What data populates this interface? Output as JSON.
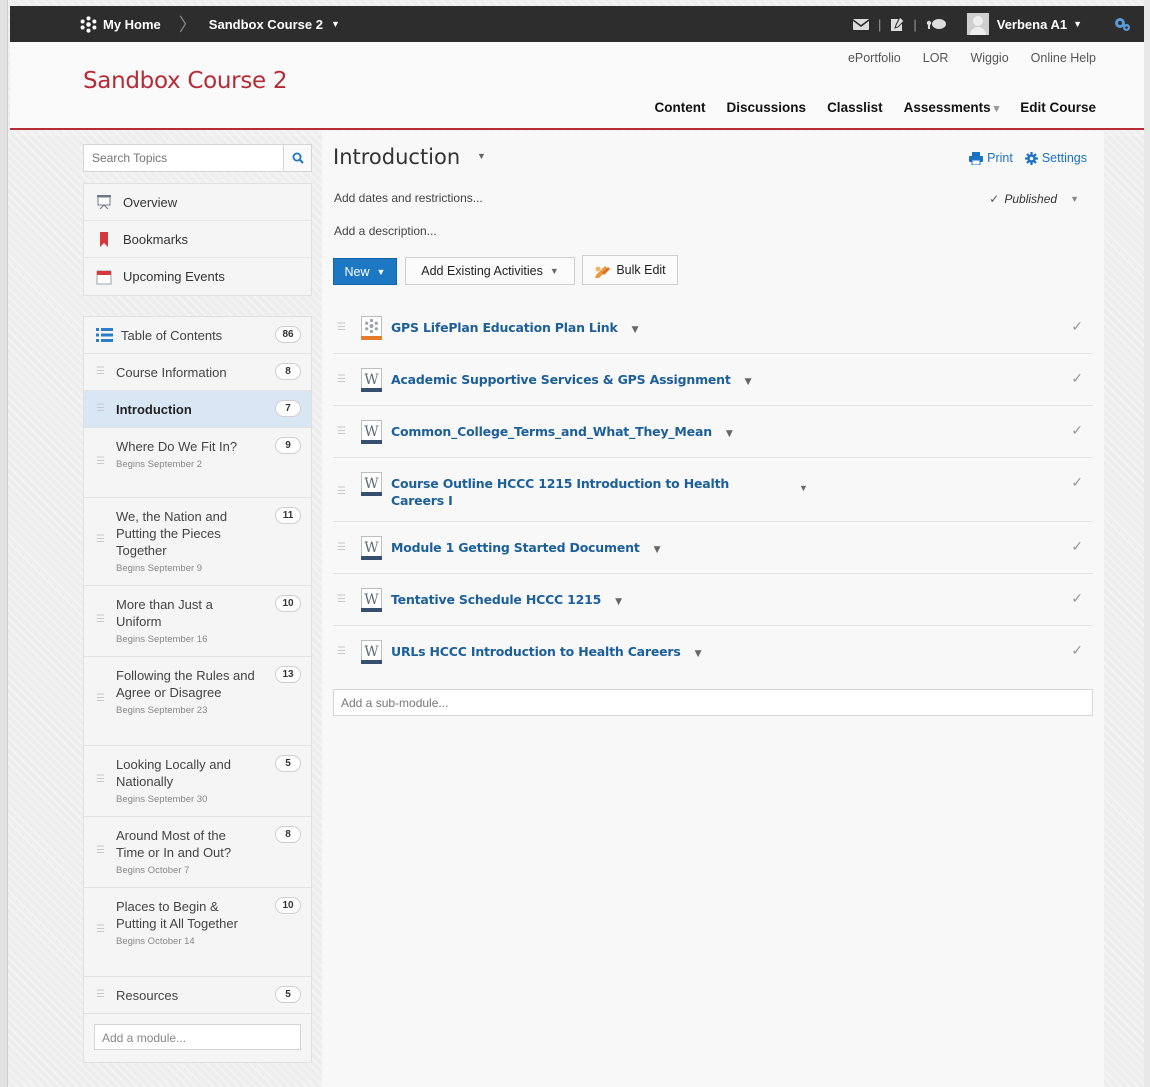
{
  "topbar": {
    "home_label": "My Home",
    "course_label": "Sandbox Course 2",
    "user_name": "Verbena A1"
  },
  "header": {
    "course_title": "Sandbox Course 2",
    "util_links": [
      "ePortfolio",
      "LOR",
      "Wiggio",
      "Online Help"
    ],
    "main_nav": [
      "Content",
      "Discussions",
      "Classlist",
      "Assessments",
      "Edit Course"
    ]
  },
  "sidebar": {
    "search_placeholder": "Search Topics",
    "nav_items": [
      "Overview",
      "Bookmarks",
      "Upcoming Events"
    ],
    "toc_label": "Table of Contents",
    "toc_count": "86",
    "modules": [
      {
        "title": "Course Information",
        "date": "",
        "count": "8"
      },
      {
        "title": "Introduction",
        "date": "",
        "count": "7"
      },
      {
        "title": "Where Do We Fit In?",
        "date": "Begins September 2",
        "count": "9"
      },
      {
        "title": "We, the Nation and Putting the Pieces Together",
        "date": "Begins September 9",
        "count": "11"
      },
      {
        "title": "More than Just a Uniform",
        "date": "Begins September 16",
        "count": "10"
      },
      {
        "title": "Following the Rules and Agree or Disagree",
        "date": "Begins September 23",
        "count": "13"
      },
      {
        "title": "Looking Locally and Nationally",
        "date": "Begins September 30",
        "count": "5"
      },
      {
        "title": "Around Most of the Time or In and Out?",
        "date": "Begins October 7",
        "count": "8"
      },
      {
        "title": "Places to Begin & Putting it All Together",
        "date": "Begins October 14",
        "count": "10"
      },
      {
        "title": "Resources",
        "date": "",
        "count": "5"
      }
    ],
    "add_module_placeholder": "Add a module..."
  },
  "main": {
    "title": "Introduction",
    "print_label": "Print",
    "settings_label": "Settings",
    "add_dates": "Add dates and restrictions...",
    "published_label": "Published",
    "add_description": "Add a description...",
    "new_button": "New",
    "add_existing_button": "Add Existing Activities",
    "bulk_edit_button": "Bulk Edit",
    "topics": [
      {
        "name": "GPS LifePlan Education Plan Link",
        "icon": "link-icon"
      },
      {
        "name": "Academic Supportive Services & GPS Assignment",
        "icon": "word-doc-icon"
      },
      {
        "name": "Common_College_Terms_and_What_They_Mean",
        "icon": "word-doc-icon"
      },
      {
        "name": "Course Outline HCCC 1215 Introduction to Health Careers I",
        "icon": "word-doc-icon"
      },
      {
        "name": "Module 1 Getting Started Document",
        "icon": "word-doc-icon"
      },
      {
        "name": "Tentative Schedule HCCC 1215",
        "icon": "word-doc-icon"
      },
      {
        "name": "URLs HCCC Introduction to Health Careers",
        "icon": "word-doc-icon"
      }
    ],
    "add_submodule_placeholder": "Add a sub-module..."
  },
  "colors": {
    "brand_red": "#b52b36",
    "link_blue": "#1c5f99",
    "accent_blue": "#1c78c2",
    "topbar_bg": "#2d2d2d",
    "active_bg": "#d9e7f5"
  }
}
